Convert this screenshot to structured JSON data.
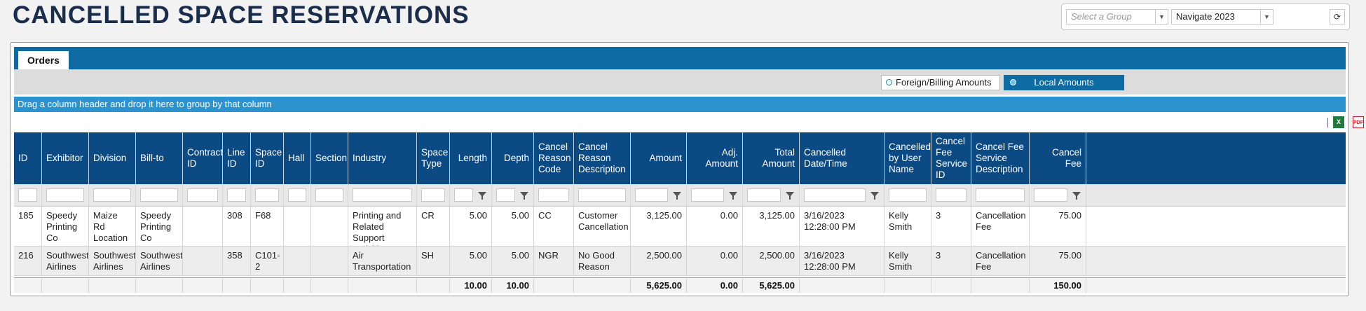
{
  "page": {
    "title": "CANCELLED SPACE RESERVATIONS"
  },
  "top_controls": {
    "group_placeholder": "Select a Group",
    "event_selected": "Navigate 2023",
    "refresh_icon": "refresh-icon"
  },
  "tabs": [
    {
      "label": "Orders"
    }
  ],
  "amount_toggle": {
    "foreign_label": "Foreign/Billing Amounts",
    "local_label": "Local Amounts",
    "selected": "local"
  },
  "group_bar": {
    "text": "Drag a column header and drop it here to group by that column"
  },
  "export": {
    "excel_icon": "excel-icon",
    "pdf_icon": "pdf-icon"
  },
  "columns": [
    "ID",
    "Exhibitor",
    "Division",
    "Bill-to",
    "Contract ID",
    "Line ID",
    "Space ID",
    "Hall",
    "Section",
    "Industry",
    "Space Type",
    "Length",
    "Depth",
    "Cancel Reason Code",
    "Cancel Reason Description",
    "Amount",
    "Adj. Amount",
    "Total Amount",
    "Cancelled Date/Time",
    "Cancelled by User Name",
    "Cancel Fee Service ID",
    "Cancel Fee Service Description",
    "Cancel Fee"
  ],
  "rows": [
    {
      "id": "185",
      "exhibitor": "Speedy Printing Co",
      "division": "Maize Rd Location",
      "bill_to": "Speedy Printing Co",
      "contract_id": "",
      "line_id": "308",
      "space_id": "F68",
      "hall": "",
      "section": "",
      "industry": "Printing and Related Support Activities",
      "space_type": "CR",
      "length": "5.00",
      "depth": "5.00",
      "cancel_code": "CC",
      "cancel_desc": "Customer Cancellation",
      "amount": "3,125.00",
      "adj_amount": "0.00",
      "total_amount": "3,125.00",
      "cancelled_at": "3/16/2023 12:28:00 PM",
      "cancelled_by": "Kelly Smith",
      "fee_service_id": "3",
      "fee_service_desc": "Cancellation Fee",
      "cancel_fee": "75.00"
    },
    {
      "id": "216",
      "exhibitor": "Southwest Airlines",
      "division": "Southwest Airlines",
      "bill_to": "Southwest Airlines",
      "contract_id": "",
      "line_id": "358",
      "space_id": "C101-2",
      "hall": "",
      "section": "",
      "industry": "Air Transportation",
      "space_type": "SH",
      "length": "5.00",
      "depth": "5.00",
      "cancel_code": "NGR",
      "cancel_desc": "No Good Reason",
      "amount": "2,500.00",
      "adj_amount": "0.00",
      "total_amount": "2,500.00",
      "cancelled_at": "3/16/2023 12:28:00 PM",
      "cancelled_by": "Kelly Smith",
      "fee_service_id": "3",
      "fee_service_desc": "Cancellation Fee",
      "cancel_fee": "75.00"
    }
  ],
  "totals": {
    "length": "10.00",
    "depth": "10.00",
    "amount": "5,625.00",
    "adj_amount": "0.00",
    "total_amount": "5,625.00",
    "cancel_fee": "150.00"
  }
}
